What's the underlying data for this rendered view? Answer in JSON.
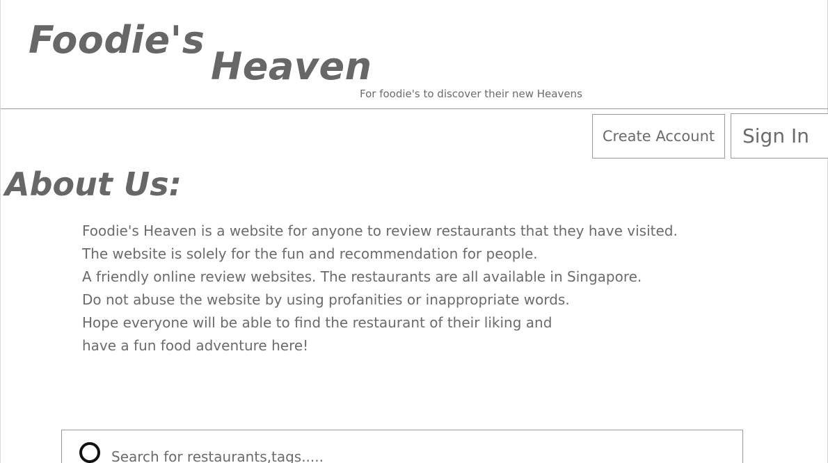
{
  "header": {
    "brand_line1": "Foodie's",
    "brand_line2": "Heaven",
    "tagline": "For foodie's to discover their new Heavens"
  },
  "auth": {
    "create_account_label": "Create Account",
    "sign_in_label": "Sign In"
  },
  "about": {
    "title": "About Us:",
    "lines": [
      "Foodie's Heaven is a website for anyone to review restaurants that they have visited.",
      "The website is solely for the fun and recommendation for people.",
      "A friendly online review websites. The restaurants are all available in Singapore.",
      "Do not abuse the website by using profanities or inappropriate words.",
      "Hope everyone will be able to find the restaurant of their liking and",
      "have a fun food adventure here!"
    ]
  },
  "search": {
    "placeholder": "Search for restaurants,tags.....",
    "icon": "search-icon"
  },
  "colors": {
    "text": "#6b6b6b",
    "border": "#9a9a9a",
    "background": "#ffffff"
  }
}
